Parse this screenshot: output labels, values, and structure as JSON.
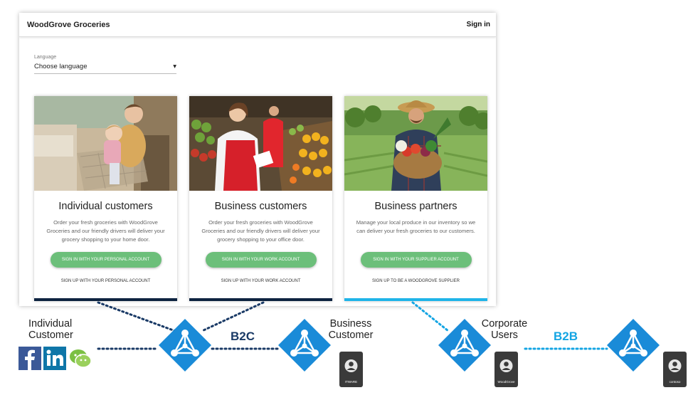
{
  "app": {
    "brand": "WoodGrove Groceries",
    "signin": "Sign in",
    "language_label": "Language",
    "language_value": "Choose language",
    "cards": [
      {
        "title": "Individual customers",
        "description": "Order your fresh groceries with WoodGrove Groceries and our friendly drivers will deliver your grocery shopping to your home door.",
        "button": "SIGN IN WITH YOUR PERSONAL ACCOUNT",
        "link": "SIGN UP WITH YOUR PERSONAL ACCOUNT",
        "bar_color": "#0d2340"
      },
      {
        "title": "Business customers",
        "description": "Order your fresh groceries with WoodGrove Groceries and our friendly drivers will deliver your grocery shopping to your office door.",
        "button": "SIGN IN WITH YOUR WORK ACCOUNT",
        "link": "SIGN UP WITH YOUR WORK ACCOUNT",
        "bar_color": "#0d2340"
      },
      {
        "title": "Business partners",
        "description": "Manage your local produce in our inventory so we can deliver your fresh groceries to our customers.",
        "button": "SIGN IN WITH YOUR SUPPLIER ACCOUNT",
        "link": "SIGN UP TO BE A WOODGROVE SUPPLIER",
        "bar_color": "#1fb4e8"
      }
    ]
  },
  "diagram": {
    "individual_label_1": "Individual",
    "individual_label_2": "Customer",
    "business_label_1": "Business",
    "business_label_2": "Customer",
    "corporate_label_1": "Corporate",
    "corporate_label_2": "Users",
    "b2c": "B2C",
    "b2b": "B2B",
    "badge_1": "ITWARE",
    "badge_2": "WoodGrove",
    "badge_3": "contoso",
    "colors": {
      "b2c_line": "#1a3a66",
      "b2b_line": "#14a5e3",
      "aad_blue": "#1a8bd8",
      "button_green": "#6cbf7a"
    }
  }
}
